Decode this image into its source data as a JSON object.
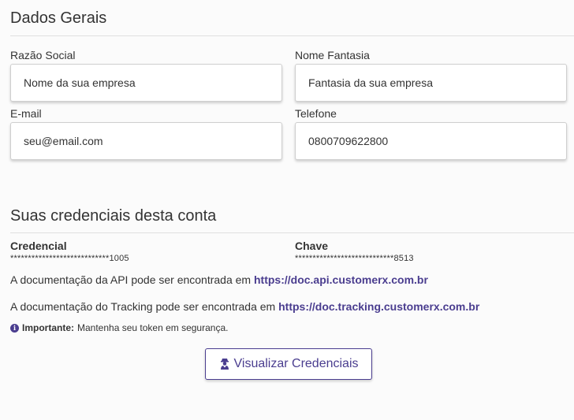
{
  "general": {
    "title": "Dados Gerais",
    "fields": {
      "razao_social": {
        "label": "Razão Social",
        "placeholder": "Nome da sua empresa"
      },
      "nome_fantasia": {
        "label": "Nome Fantasia",
        "placeholder": "Fantasia da sua empresa"
      },
      "email": {
        "label": "E-mail",
        "placeholder": "seu@email.com"
      },
      "telefone": {
        "label": "Telefone",
        "value": "0800709622800"
      }
    }
  },
  "credentials": {
    "title": "Suas credenciais desta conta",
    "credencial": {
      "label": "Credencial",
      "value": "****************************1005"
    },
    "chave": {
      "label": "Chave",
      "value": "****************************8513"
    },
    "api_doc": {
      "text": "A documentação da API pode ser encontrada em ",
      "link": "https://doc.api.customerx.com.br"
    },
    "tracking_doc": {
      "text": "A documentação do Tracking pode ser encontrada em ",
      "link": "https://doc.tracking.customerx.com.br"
    },
    "notice": {
      "icon": "info-icon",
      "strong": "Importante:",
      "text": "Mantenha seu token em segurança."
    },
    "button": {
      "icon": "user-secret-icon",
      "label": "Visualizar Credenciais"
    }
  },
  "colors": {
    "accent": "#4a3d8f",
    "text": "#333333",
    "background": "#fbfbfb"
  }
}
